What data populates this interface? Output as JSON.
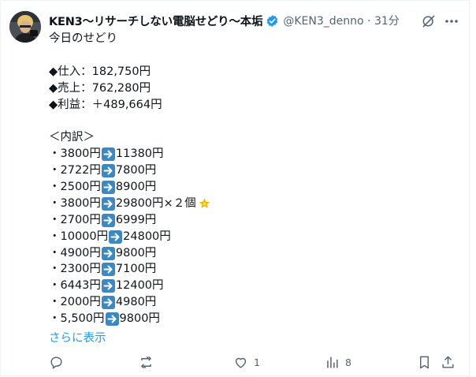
{
  "tweet": {
    "author_name": "KEN3〜リサーチしない電脳せどり〜本垢",
    "handle_time": "@KEN3_denno · 31分",
    "heading": "今日のせどり",
    "summary": [
      "◆仕入：182,750円",
      "◆売上：762,280円",
      "◆利益：＋489,664円"
    ],
    "breakdown_title": "＜内訳＞",
    "items": [
      {
        "from": "・3800円",
        "to": "11380円",
        "extra": ""
      },
      {
        "from": "・2722円",
        "to": "7800円",
        "extra": ""
      },
      {
        "from": "・2500円",
        "to": "8900円",
        "extra": ""
      },
      {
        "from": "・3800円",
        "to": "29800円",
        "extra": "×２個"
      },
      {
        "from": "・2700円",
        "to": "6999円",
        "extra": ""
      },
      {
        "from": "・10000円",
        "to": "24800円",
        "extra": ""
      },
      {
        "from": "・4900円",
        "to": "9800円",
        "extra": ""
      },
      {
        "from": "・2300円",
        "to": "7100円",
        "extra": ""
      },
      {
        "from": "・6443円",
        "to": "12400円",
        "extra": ""
      },
      {
        "from": "・2000円",
        "to": "4980円",
        "extra": ""
      },
      {
        "from": "・5,500円",
        "to": "9800円",
        "extra": ""
      }
    ],
    "show_more": "さらに表示"
  },
  "actions": {
    "like_count": "1",
    "views_count": "8"
  },
  "colors": {
    "text": "#0f1419",
    "secondary": "#536471",
    "link": "#1d9bf0",
    "arrow_emoji": "#3b88c3",
    "verified": "#1d9bf0"
  }
}
